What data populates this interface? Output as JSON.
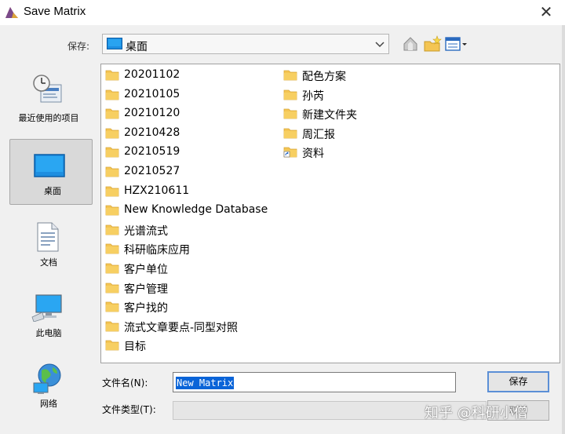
{
  "window": {
    "title": "Save Matrix",
    "close_glyph": "✕"
  },
  "toolbar": {
    "save_in_label": "保存:",
    "location": "桌面",
    "up_icon": "up-folder-icon",
    "new_folder_icon": "new-folder-icon",
    "view_icon": "view-menu-icon"
  },
  "places": [
    {
      "label": "最近使用的项目",
      "icon": "recent-items-icon"
    },
    {
      "label": "桌面",
      "icon": "desktop-icon",
      "selected": true
    },
    {
      "label": "文档",
      "icon": "documents-icon"
    },
    {
      "label": "此电脑",
      "icon": "this-pc-icon"
    },
    {
      "label": "网络",
      "icon": "network-icon"
    }
  ],
  "files": {
    "column1": [
      "20201102",
      "20210105",
      "20210120",
      "20210428",
      "20210519",
      "20210527",
      "HZX210611",
      "New Knowledge Database",
      "光谱流式",
      "科研临床应用",
      "客户单位",
      "客户管理",
      "客户找的",
      "流式文章要点-同型对照",
      "目标"
    ],
    "column2": [
      "配色方案",
      "孙芮",
      "新建文件夹",
      "周汇报",
      "资料"
    ]
  },
  "form": {
    "filename_label": "文件名(N):",
    "filename_value": "New Matrix",
    "filetype_label": "文件类型(T):",
    "filetype_value": ""
  },
  "buttons": {
    "save": "保存",
    "cancel": "取消"
  },
  "watermark": "知乎 @科研小僧",
  "colors": {
    "selection": "#0a64d8",
    "folder": "#f4c553",
    "default_button_border": "#5b8fd6"
  }
}
